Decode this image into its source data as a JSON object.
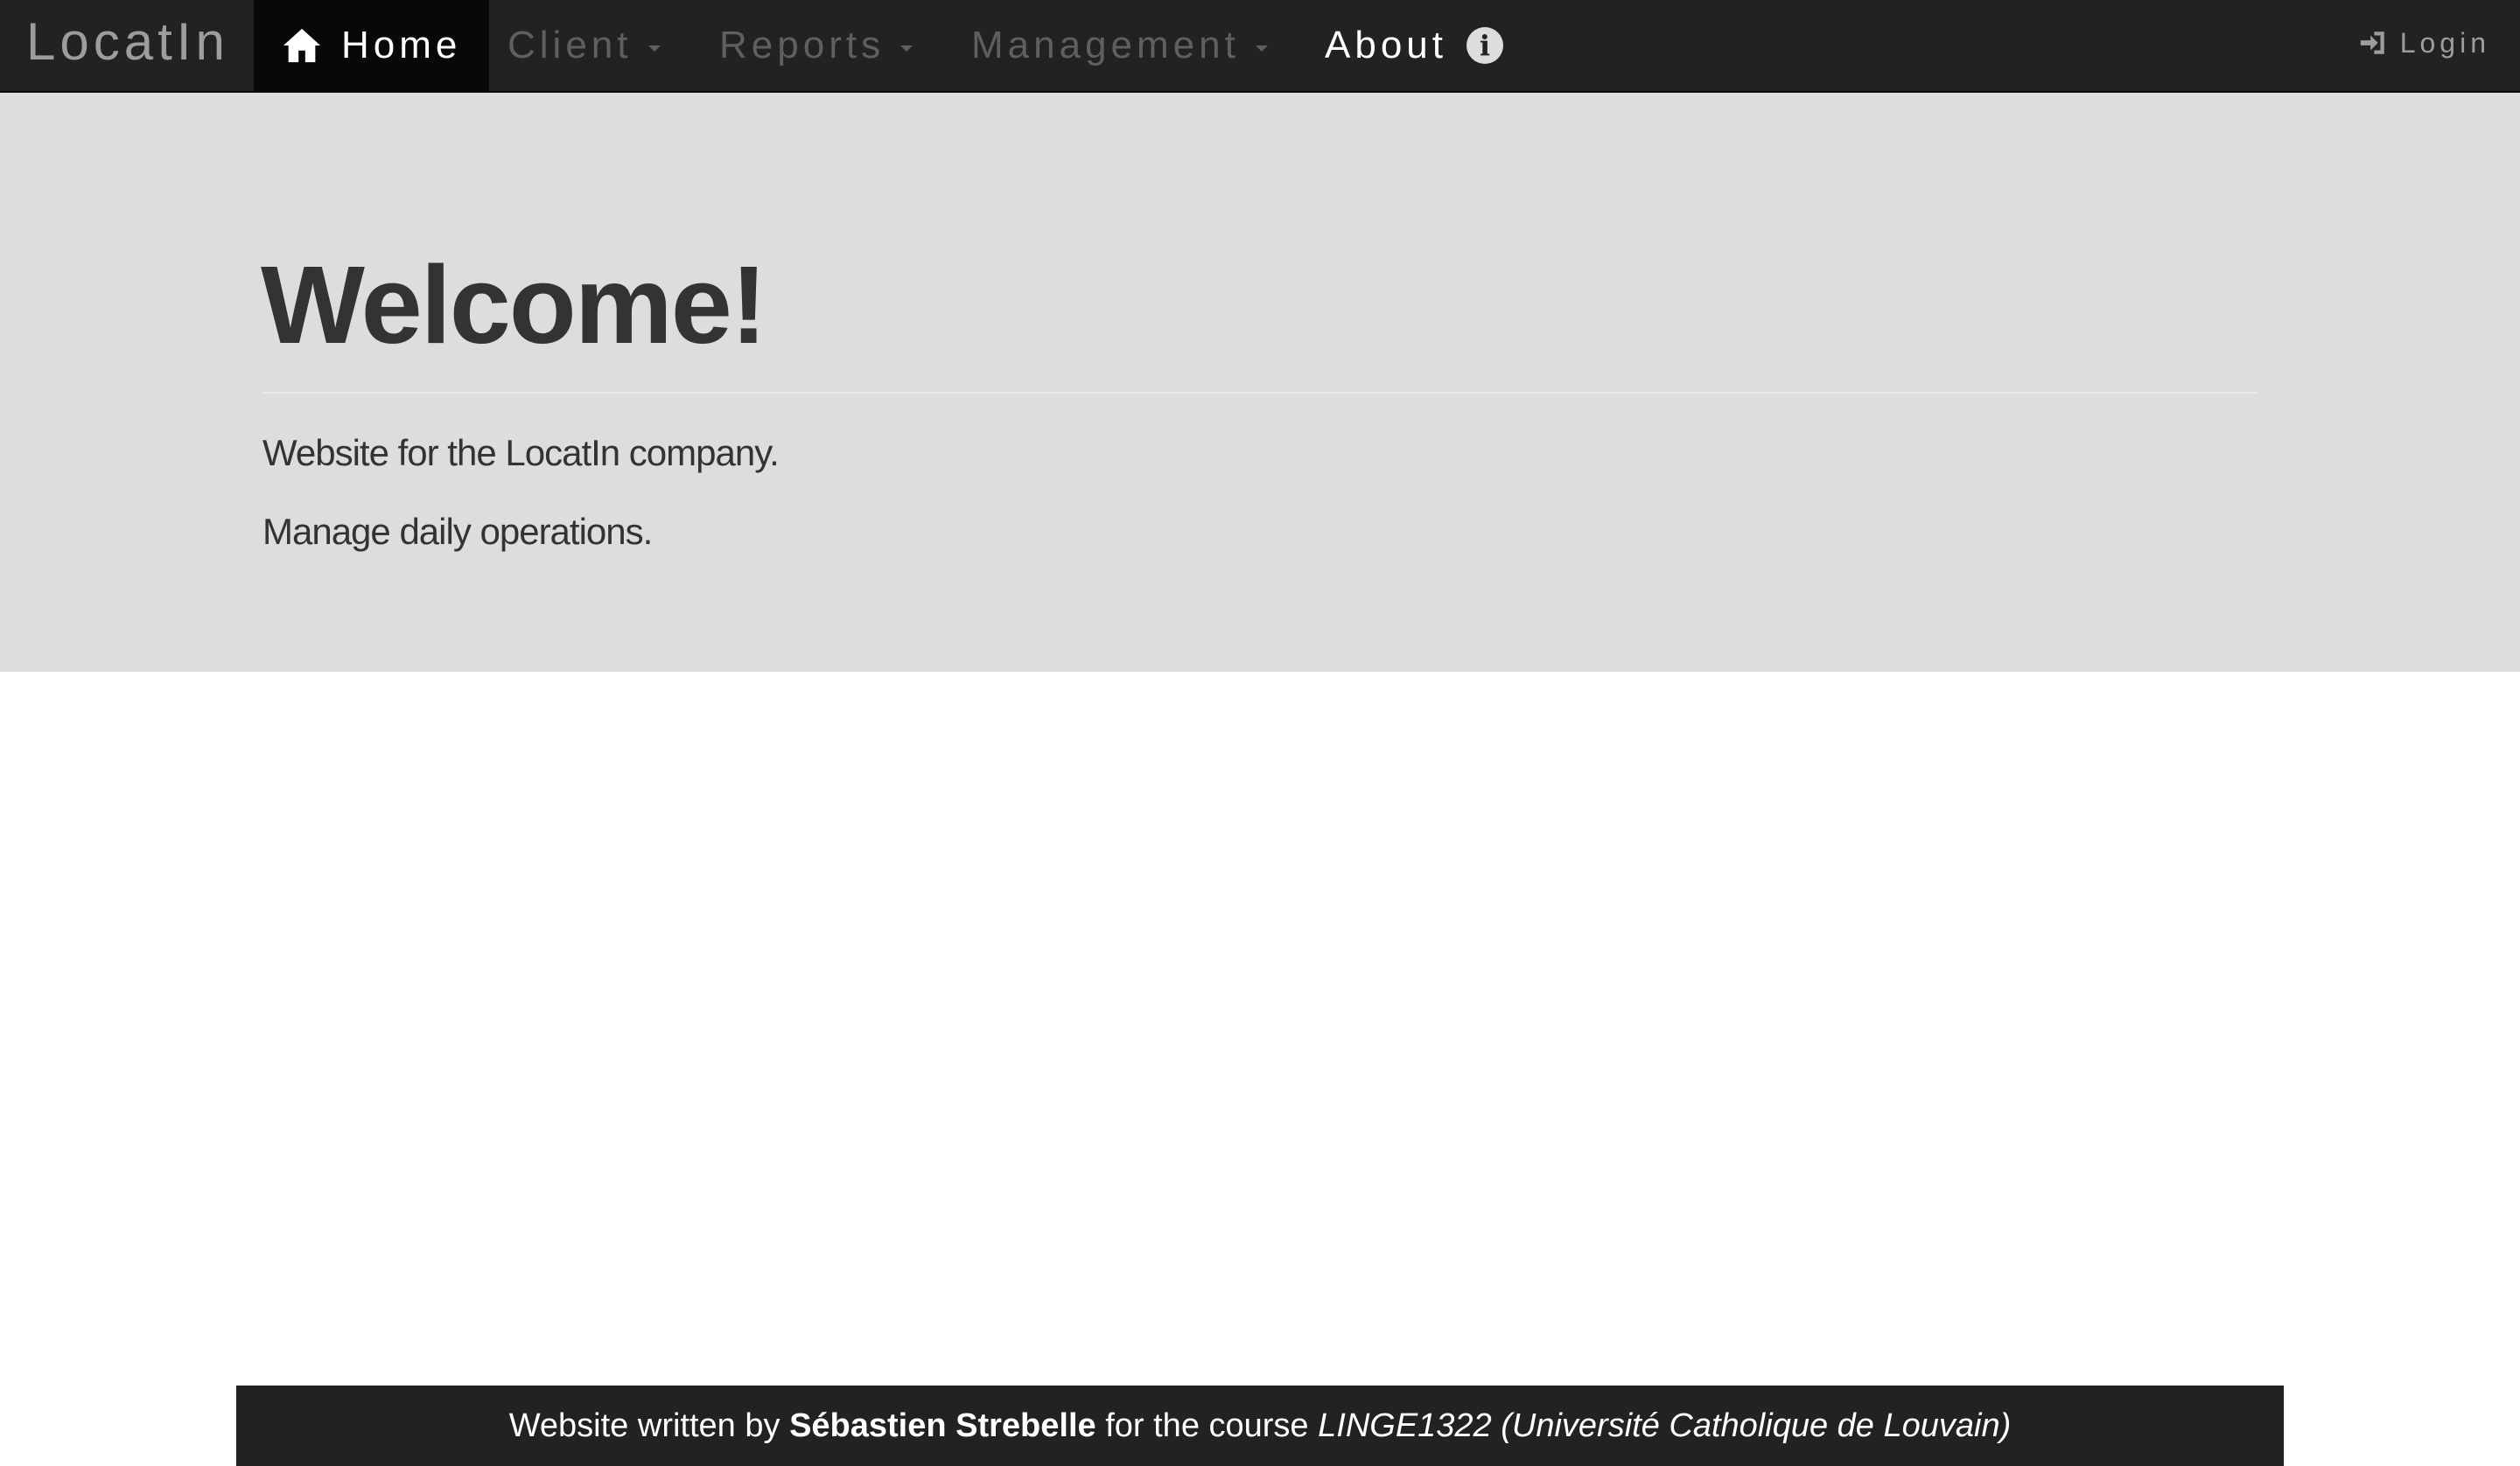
{
  "navbar": {
    "brand": "LocatIn",
    "items": [
      {
        "label": "Home",
        "icon": "home-icon",
        "active": true
      },
      {
        "label": "Client",
        "icon": "caret-down-icon",
        "dropdown": true
      },
      {
        "label": "Reports",
        "icon": "caret-down-icon",
        "dropdown": true
      },
      {
        "label": "Management",
        "icon": "caret-down-icon",
        "dropdown": true
      },
      {
        "label": "About",
        "icon": "info-icon"
      }
    ],
    "login": {
      "label": "Login",
      "icon": "login-icon"
    }
  },
  "jumbotron": {
    "title": "Welcome!",
    "lines": [
      "Website for the LocatIn company.",
      "Manage daily operations."
    ]
  },
  "footer": {
    "prefix": "Website written by",
    "author": "Sébastien Strebelle",
    "middle": "for the course",
    "course": "LINGE1322 (Université Catholique de Louvain)"
  },
  "colors": {
    "navbar_bg": "#222222",
    "active_bg": "#080808",
    "jumbotron_bg": "#dddddd",
    "muted_text": "#9d9d9d",
    "text": "#333333"
  }
}
